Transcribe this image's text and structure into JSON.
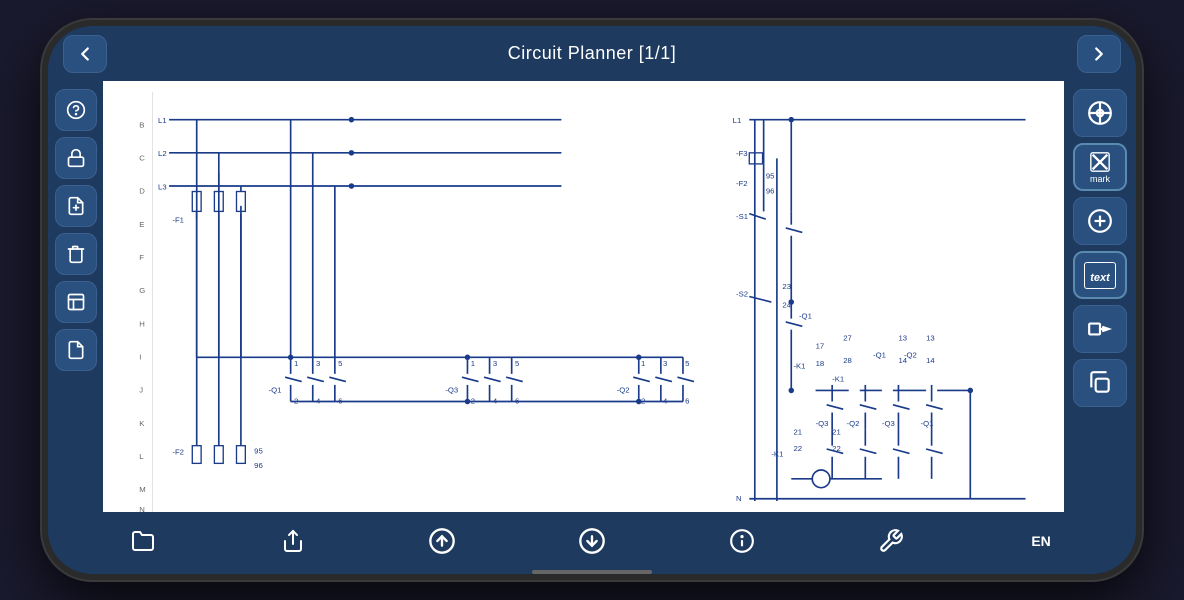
{
  "header": {
    "title": "Circuit Planner [1/1]",
    "back_icon": "←",
    "forward_icon": "→"
  },
  "left_sidebar": {
    "buttons": [
      {
        "name": "help",
        "icon": "?",
        "label": "help-button"
      },
      {
        "name": "lock",
        "icon": "🔒",
        "label": "lock-button"
      },
      {
        "name": "add-page",
        "icon": "+",
        "label": "add-page-button"
      },
      {
        "name": "delete",
        "icon": "🗑",
        "label": "delete-button"
      },
      {
        "name": "page",
        "icon": "📄",
        "label": "page-button"
      },
      {
        "name": "file",
        "icon": "📁",
        "label": "file-button"
      }
    ]
  },
  "right_sidebar": {
    "buttons": [
      {
        "name": "crosshair",
        "icon": "⊕",
        "label": "",
        "has_label": false
      },
      {
        "name": "mark",
        "icon": "✕",
        "label": "mark",
        "has_label": true
      },
      {
        "name": "add-circle",
        "icon": "⊕",
        "label": "",
        "has_label": false
      },
      {
        "name": "text",
        "icon": "text",
        "label": "",
        "has_label": false,
        "is_text": true
      },
      {
        "name": "move",
        "icon": "→",
        "label": "",
        "has_label": false
      },
      {
        "name": "copy",
        "icon": "⧉",
        "label": "",
        "has_label": false
      }
    ]
  },
  "footer": {
    "buttons": [
      {
        "name": "folder",
        "icon": "folder",
        "label": "open-folder-button"
      },
      {
        "name": "share",
        "icon": "share",
        "label": "share-button"
      },
      {
        "name": "upload",
        "icon": "upload",
        "label": "upload-button"
      },
      {
        "name": "download",
        "icon": "download",
        "label": "download-button"
      },
      {
        "name": "info",
        "icon": "info",
        "label": "info-button"
      },
      {
        "name": "settings",
        "icon": "wrench",
        "label": "settings-button"
      },
      {
        "name": "language",
        "icon": "EN",
        "label": "language-button"
      }
    ]
  },
  "canvas": {
    "description": "Circuit diagram with ladder logic",
    "row_labels": [
      "B",
      "C",
      "D",
      "E",
      "F",
      "G",
      "H",
      "I",
      "J",
      "K",
      "L",
      "M",
      "N"
    ],
    "components": [
      "L1",
      "L2",
      "L3",
      "-F1",
      "-F2",
      "-Q1",
      "-Q2",
      "-Q3",
      "-K1",
      "-S1",
      "-S2"
    ]
  }
}
